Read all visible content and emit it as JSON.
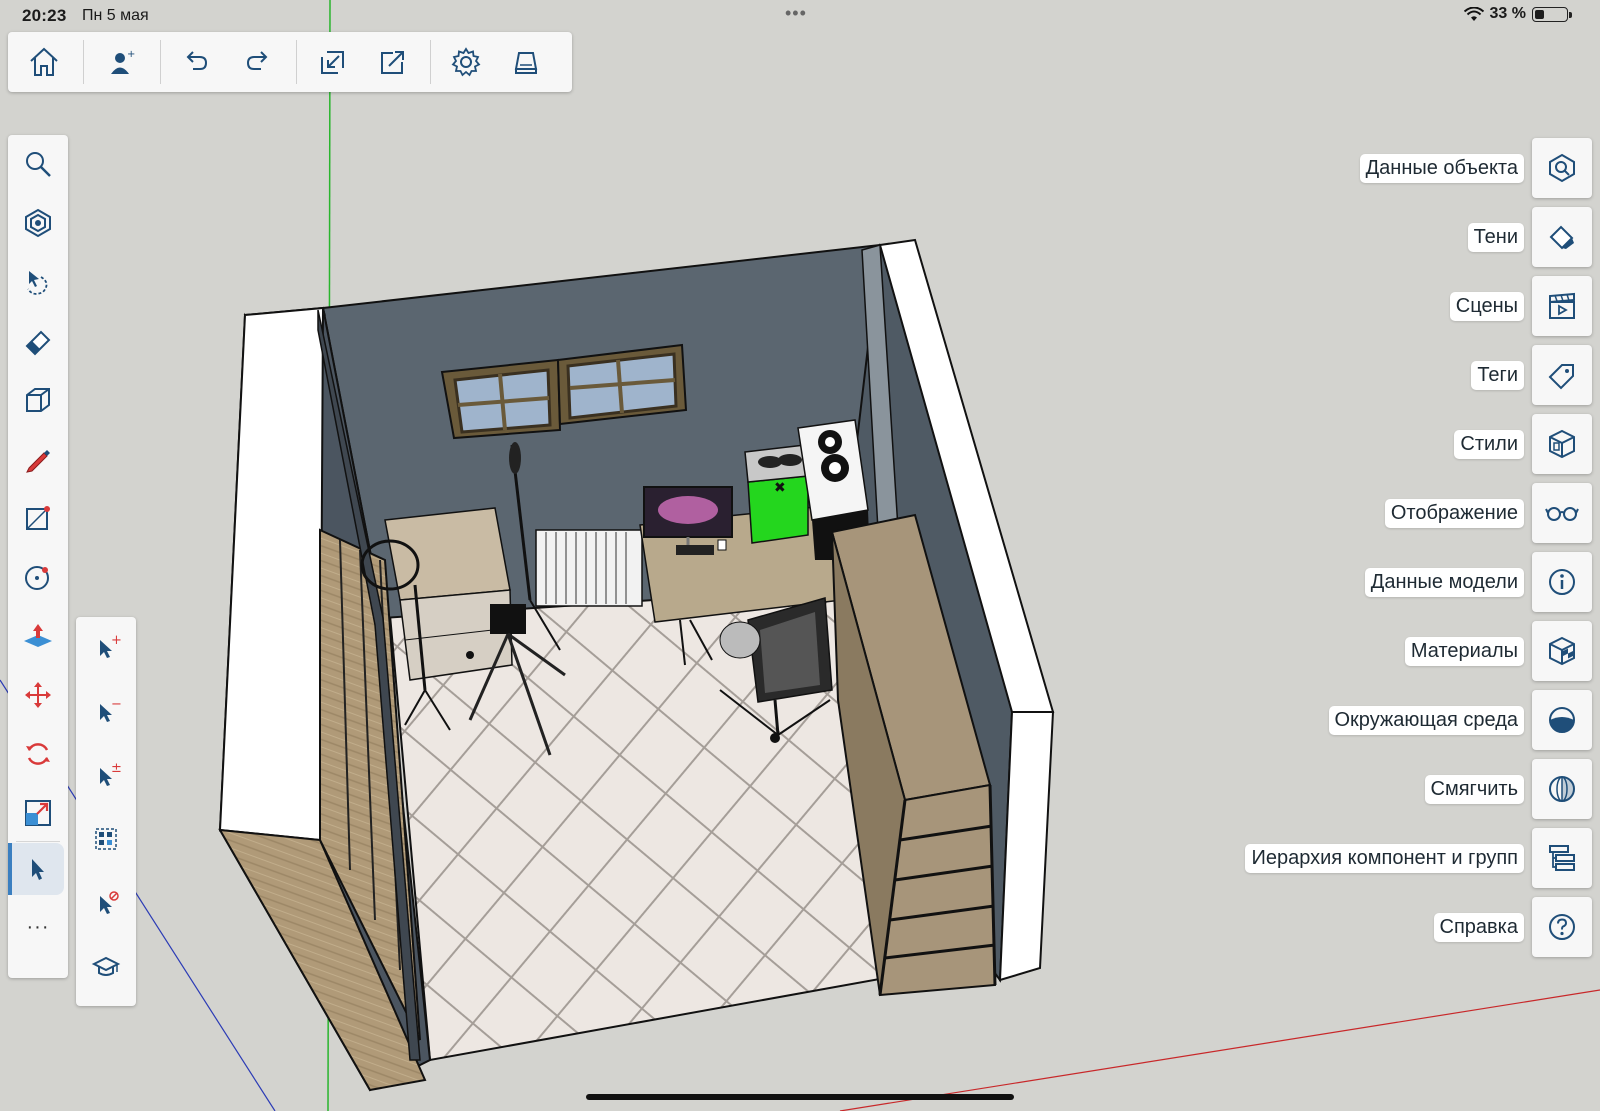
{
  "status_bar": {
    "time": "20:23",
    "date": "Пн 5 мая",
    "center_dots": "•••",
    "battery_percent": "33 %",
    "battery_level": 0.33
  },
  "top_toolbar": {
    "buttons": [
      {
        "name": "home-button",
        "icon": "home-icon"
      },
      {
        "name": "add-user-button",
        "icon": "user-add-icon"
      },
      {
        "name": "undo-button",
        "icon": "undo-icon"
      },
      {
        "name": "redo-button",
        "icon": "redo-icon"
      },
      {
        "name": "import-button",
        "icon": "import-icon"
      },
      {
        "name": "export-button",
        "icon": "export-icon"
      },
      {
        "name": "settings-button",
        "icon": "gear-icon"
      },
      {
        "name": "print-button",
        "icon": "tray-icon"
      }
    ]
  },
  "left_toolbar": {
    "tools": [
      "search-icon",
      "component-icon",
      "lasso-select-icon",
      "eraser-icon",
      "box-icon",
      "pencil-icon",
      "rectangle-icon",
      "circle-icon",
      "push-pull-icon",
      "move-icon",
      "rotate-icon",
      "scale-icon",
      "select-icon"
    ],
    "more_label": "···"
  },
  "select_submenu": {
    "tools": [
      "select-add-icon",
      "select-remove-icon",
      "select-toggle-icon",
      "select-all-icon",
      "select-none-icon",
      "tutorial-cap-icon"
    ]
  },
  "panels": [
    {
      "label": "Данные объекта",
      "icon": "entity-info-icon"
    },
    {
      "label": "Тени",
      "icon": "shadows-icon"
    },
    {
      "label": "Сцены",
      "icon": "scenes-clapper-icon"
    },
    {
      "label": "Теги",
      "icon": "tag-icon"
    },
    {
      "label": "Стили",
      "icon": "styles-cube-icon"
    },
    {
      "label": "Отображение",
      "icon": "glasses-icon"
    },
    {
      "label": "Данные модели",
      "icon": "info-icon"
    },
    {
      "label": "Материалы",
      "icon": "materials-cube-icon"
    },
    {
      "label": "Окружающая среда",
      "icon": "environment-icon"
    },
    {
      "label": "Смягчить",
      "icon": "soften-sphere-icon"
    },
    {
      "label": "Иерархия компонент и групп",
      "icon": "outliner-icon"
    },
    {
      "label": "Справка",
      "icon": "help-icon"
    }
  ],
  "colors": {
    "canvas": "#d3d3cf",
    "wall_inner": "#5b6670",
    "wall_outer": "#ffffff",
    "floor": "#ede7e2",
    "green_axis": "#29b52d",
    "red_axis": "#c8282a",
    "blue_axis": "#2b3bb5",
    "accent": "#1f4e79"
  }
}
